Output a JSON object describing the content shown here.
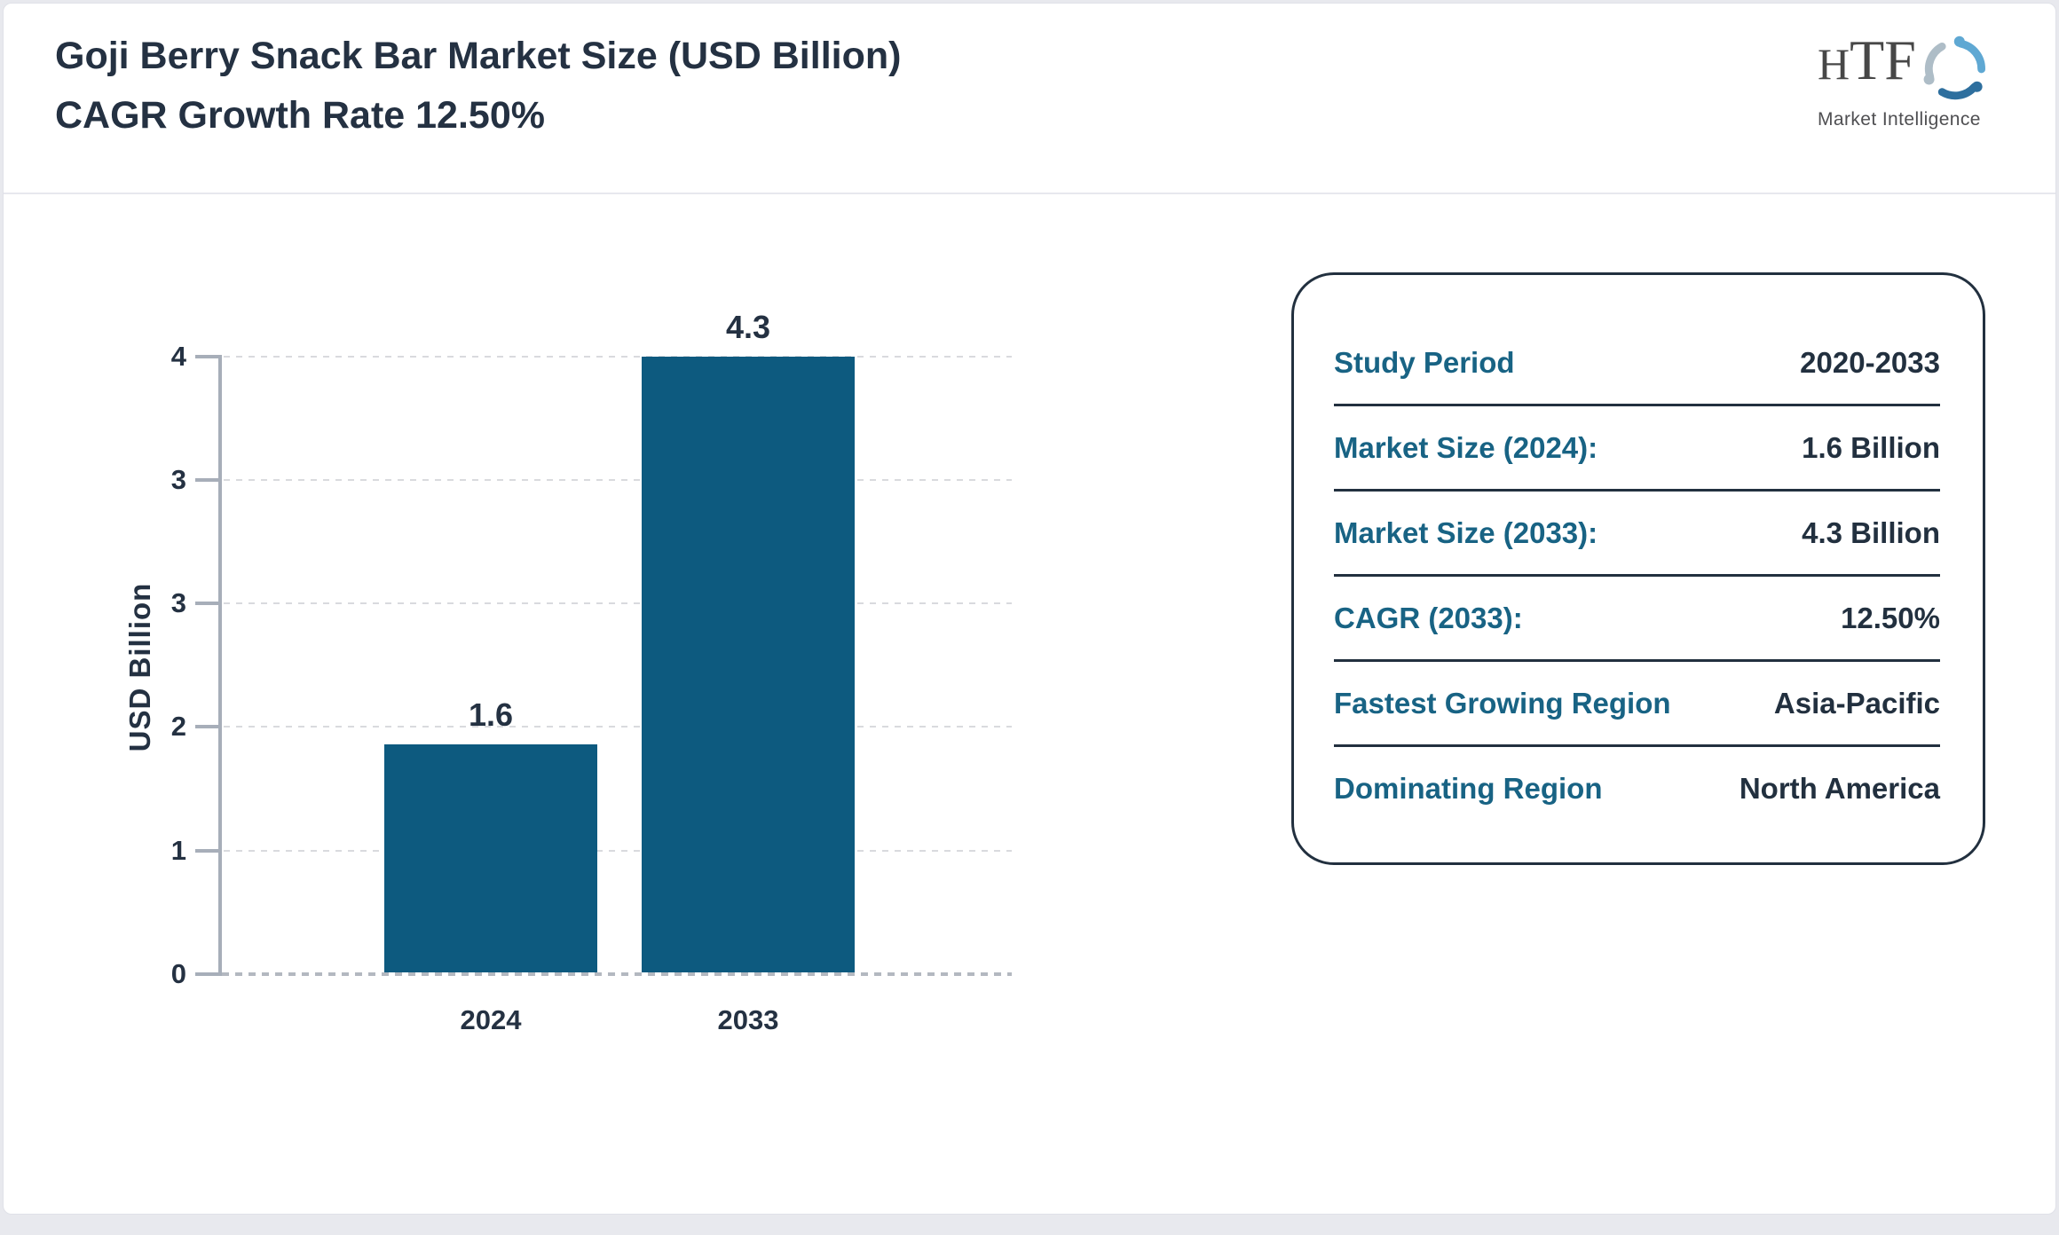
{
  "header": {
    "title_line1": "Goji Berry Snack Bar Market Size (USD Billion)",
    "title_line2": "CAGR Growth Rate 12.50%"
  },
  "logo": {
    "name": "HTF",
    "tagline": "Market Intelligence",
    "icon": "three-figures-swirl-icon",
    "icon_colors": {
      "light_blue": "#5fa8d3",
      "steel_blue": "#2e6f9e",
      "gray": "#aebdc7"
    }
  },
  "chart_data": {
    "type": "bar",
    "title": "Goji Berry Snack Bar Market Size (USD Billion) CAGR Growth Rate 12.50%",
    "categories": [
      "2024",
      "2033"
    ],
    "values": [
      1.6,
      4.3
    ],
    "value_labels": [
      "1.6",
      "4.3"
    ],
    "xlabel": "",
    "ylabel": "USD Billion",
    "ylim": [
      0,
      4.3
    ],
    "yticks": [
      "4",
      "3",
      "3",
      "2",
      "1",
      "0"
    ],
    "grid": true,
    "legend": false,
    "gridline_style": "dotted",
    "bar_color": "#0d5a7f"
  },
  "panel": {
    "rows": [
      {
        "label": "Study Period",
        "value": "2020-2033"
      },
      {
        "label": "Market Size (2024):",
        "value": "1.6 Billion"
      },
      {
        "label": "Market Size (2033):",
        "value": "4.3 Billion"
      },
      {
        "label": "CAGR (2033):",
        "value": "12.50%"
      },
      {
        "label": "Fastest Growing Region",
        "value": "Asia-Pacific"
      },
      {
        "label": "Dominating Region",
        "value": "North America"
      }
    ],
    "label_color": "#186384",
    "value_color": "#22303f",
    "border_color": "#22303f"
  }
}
